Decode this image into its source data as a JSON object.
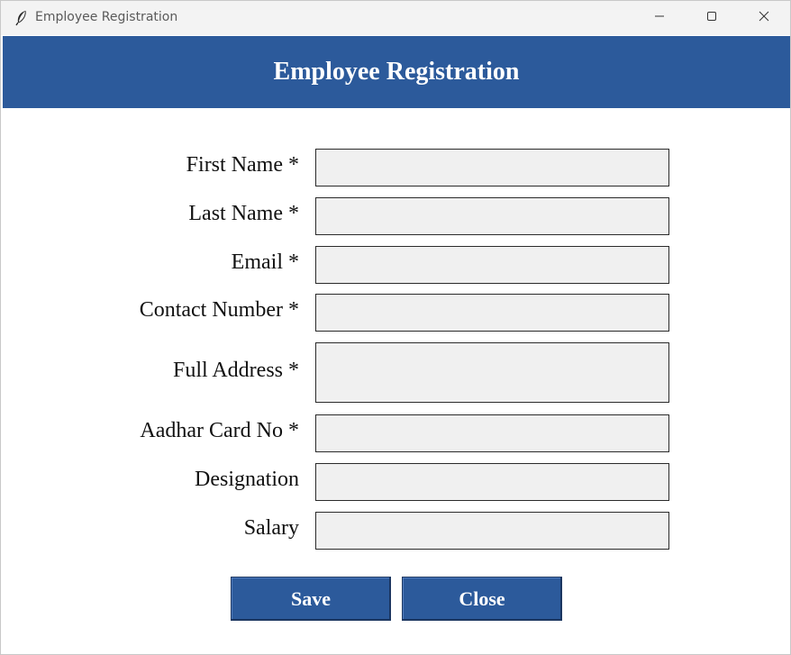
{
  "window": {
    "title": "Employee Registration",
    "controls": [
      "minimize",
      "maximize",
      "close"
    ]
  },
  "header": {
    "title": "Employee Registration",
    "background_color": "#2c5a9b"
  },
  "form": {
    "fields": [
      {
        "label": "First Name *",
        "value": ""
      },
      {
        "label": "Last Name *",
        "value": ""
      },
      {
        "label": "Email *",
        "value": ""
      },
      {
        "label": "Contact Number *",
        "value": ""
      },
      {
        "label": "Full Address *",
        "value": ""
      },
      {
        "label": "Aadhar Card No *",
        "value": ""
      },
      {
        "label": "Designation",
        "value": ""
      },
      {
        "label": "Salary",
        "value": ""
      }
    ]
  },
  "buttons": {
    "save_label": "Save",
    "close_label": "Close",
    "color": "#2c5a9b"
  },
  "icons": {
    "app": "feather-icon",
    "minimize": "minimize-icon",
    "maximize": "maximize-icon",
    "close": "close-icon"
  }
}
